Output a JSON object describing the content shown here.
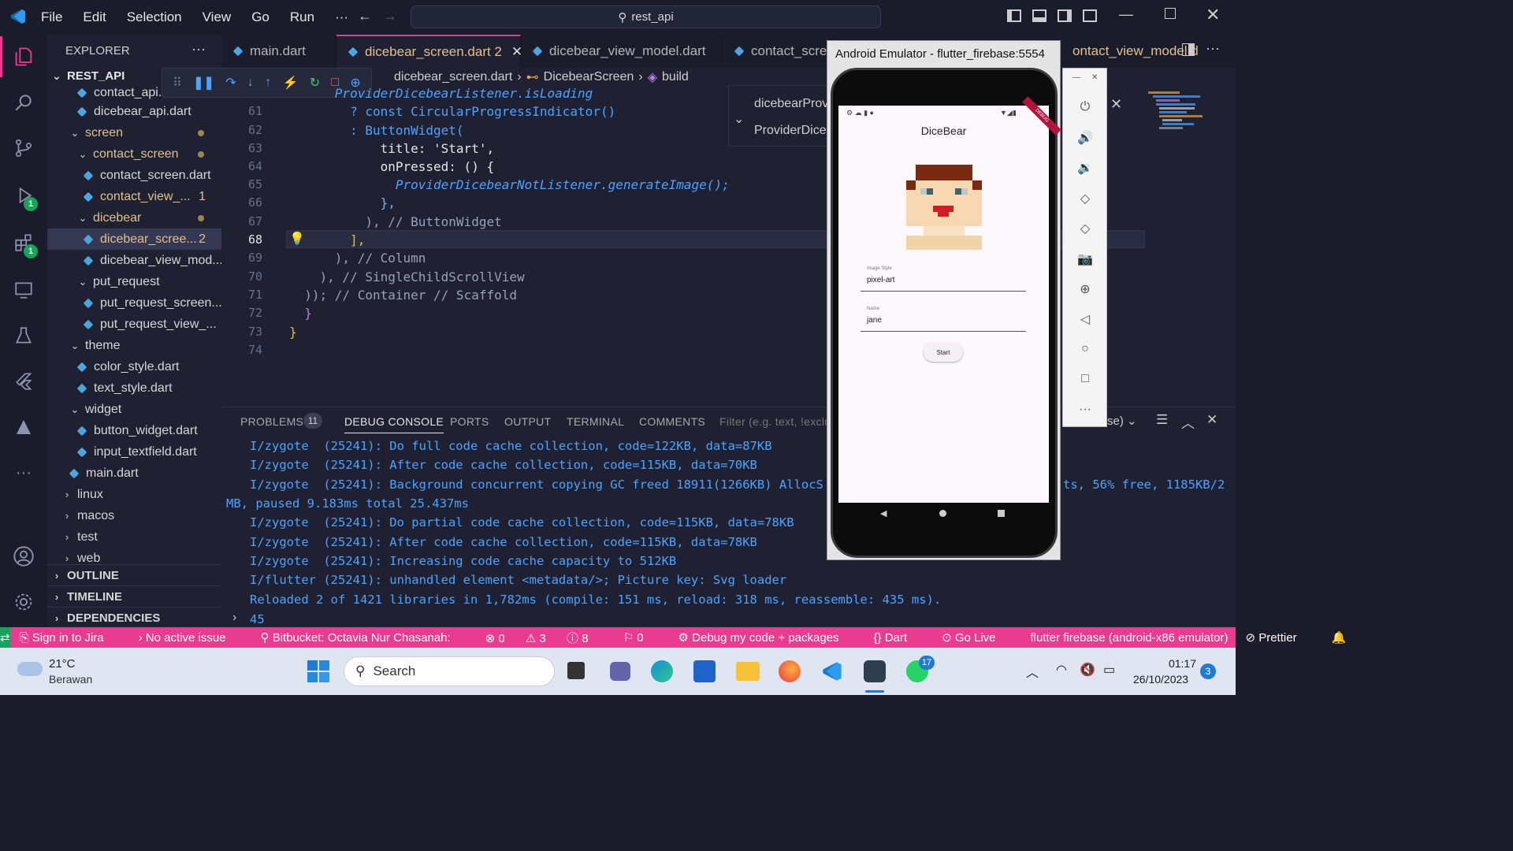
{
  "menu": {
    "file": "File",
    "edit": "Edit",
    "selection": "Selection",
    "view": "View",
    "go": "Go",
    "run": "Run",
    "more": "···"
  },
  "search": {
    "label": "rest_api"
  },
  "explorer": {
    "title": "EXPLORER",
    "more": "···",
    "root": "REST_API",
    "items": [
      "contact_api.d",
      "dicebear_api.dart",
      "screen",
      "contact_screen",
      "contact_screen.dart",
      "contact_view_...",
      "dicebear",
      "dicebear_scree...",
      "dicebear_view_mod...",
      "put_request",
      "put_request_screen....",
      "put_request_view_...",
      "theme",
      "color_style.dart",
      "text_style.dart",
      "widget",
      "button_widget.dart",
      "input_textfield.dart",
      "main.dart",
      "linux",
      "macos",
      "test",
      "web"
    ],
    "badges": {
      "contact_view": "1",
      "dicebear_screen": "2"
    },
    "sections": [
      "OUTLINE",
      "TIMELINE",
      "DEPENDENCIES"
    ]
  },
  "activity_badges": {
    "debug": "1",
    "extensions": "1"
  },
  "tabs": [
    {
      "label": "main.dart"
    },
    {
      "label": "dicebear_screen.dart 2"
    },
    {
      "label": "dicebear_view_model.dart"
    },
    {
      "label": "contact_scree"
    },
    {
      "label": "ontact_view_model.d"
    }
  ],
  "breadcrumb": {
    "file": "dicebear_screen.dart",
    "cls": "DicebearScreen",
    "method": "build"
  },
  "peek": {
    "line1": "dicebearProvi",
    "line2": "ProviderDiceb"
  },
  "code": {
    "lines": [
      {
        "n": "",
        "t": "      ProviderDicebearListener.isLoading"
      },
      {
        "n": "61",
        "t": "        ? const CircularProgressIndicator()"
      },
      {
        "n": "62",
        "t": "        : ButtonWidget("
      },
      {
        "n": "63",
        "t": "            title: 'Start',"
      },
      {
        "n": "64",
        "t": "            onPressed: () {"
      },
      {
        "n": "65",
        "t": "              ProviderDicebearNotListener.generateImage();"
      },
      {
        "n": "66",
        "t": "            },"
      },
      {
        "n": "67",
        "t": "          ), // ButtonWidget"
      },
      {
        "n": "68",
        "t": "        ],"
      },
      {
        "n": "69",
        "t": "      ), // Column"
      },
      {
        "n": "70",
        "t": "    ), // SingleChildScrollView"
      },
      {
        "n": "71",
        "t": "  )); // Container // Scaffold"
      },
      {
        "n": "72",
        "t": "  }"
      },
      {
        "n": "73",
        "t": "}"
      },
      {
        "n": "74",
        "t": ""
      }
    ]
  },
  "panel": {
    "problems": "PROBLEMS",
    "problems_count": "11",
    "debug": "DEBUG CONSOLE",
    "ports": "PORTS",
    "output": "OUTPUT",
    "terminal": "TERMINAL",
    "comments": "COMMENTS",
    "filter": "Filter (e.g. text, !exclu",
    "select_tail": "se)",
    "logs": [
      "I/zygote  (25241): Do full code cache collection, code=122KB, data=87KB",
      "I/zygote  (25241): After code cache collection, code=115KB, data=70KB",
      "I/zygote  (25241): Background concurrent copying GC freed 18911(1266KB) AllocS",
      "MB, paused 9.183ms total 25.437ms",
      "I/zygote  (25241): Do partial code cache collection, code=115KB, data=78KB",
      "I/zygote  (25241): After code cache collection, code=115KB, data=78KB",
      "I/zygote  (25241): Increasing code cache capacity to 512KB",
      "I/flutter (25241): unhandled element <metadata/>; Picture key: Svg loader",
      "Reloaded 2 of 1421 libraries in 1,782ms (compile: 151 ms, reload: 318 ms, reassemble: 435 ms)."
    ],
    "log_tail": "ts, 56% free, 1185KB/2",
    "prompt_value": "45"
  },
  "emulator": {
    "title": "Android Emulator - flutter_firebase:5554",
    "app_title": "DiceBear",
    "debug_banner": "DEBUG",
    "style_label": "Image Style",
    "style_value": "pixel-art",
    "name_label": "Name",
    "name_value": "jane",
    "start": "Start"
  },
  "status": {
    "sign_in": "Sign in to Jira",
    "issue": "No active issue",
    "bitbucket": "Bitbucket: Octavia Nur Chasanah:",
    "errors": "0",
    "warnings": "3",
    "info": "8",
    "ports": "0",
    "debug": "Debug my code + packages",
    "lang": "Dart",
    "live": "Go Live",
    "device": "flutter firebase (android-x86 emulator)",
    "prettier": "Prettier"
  },
  "taskbar": {
    "temp": "21°C",
    "weather": "Berawan",
    "search": "Search",
    "time": "01:17",
    "date": "26/10/2023",
    "notif": "3",
    "whatsapp_badge": "17"
  },
  "colors": {
    "status": "#e93b8f",
    "accent": "#4aa3ff"
  }
}
